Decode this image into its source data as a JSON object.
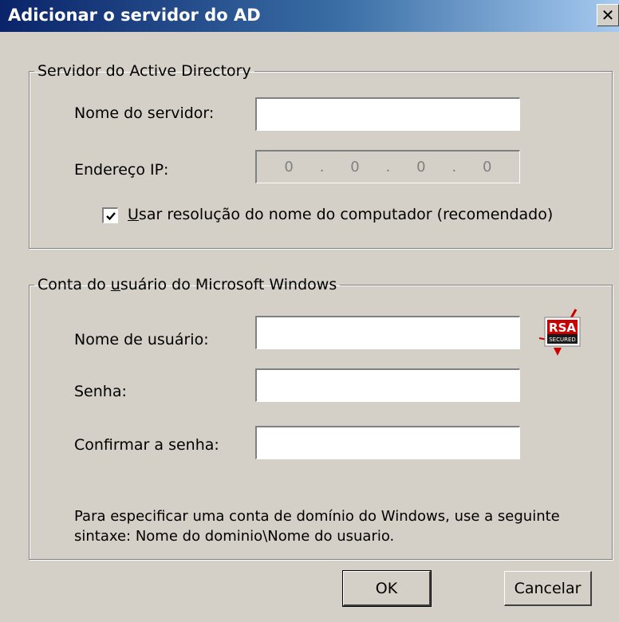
{
  "window": {
    "title": "Adicionar o servidor do AD",
    "close_label": "✕"
  },
  "ad_server_group": {
    "legend": "Servidor do Active Directory",
    "server_name_label": "Nome do servidor:",
    "server_name_value": "",
    "ip_label": "Endereço IP:",
    "ip_octets": [
      "0",
      "0",
      "0",
      "0"
    ],
    "ip_separator": ".",
    "use_name_resolution": {
      "checked": true,
      "label": "Usar resolução do nome do computador (recomendado)"
    }
  },
  "windows_account_group": {
    "legend": "Conta do usuário do Microsoft Windows",
    "username_label": "Nome de usuário:",
    "username_value": "",
    "password_label": "Senha:",
    "password_value": "",
    "confirm_label": "Confirmar a senha:",
    "confirm_value": "",
    "note_line1": "Para especificar uma conta de domínio do Windows, use a seguinte",
    "note_line2": "sintaxe: Nome  do  dominio\\Nome  do  usuario.",
    "logo": {
      "text": "RSA",
      "subtext": "SECURED",
      "icon": "rsa-secured-icon",
      "color": "#cc0000"
    }
  },
  "buttons": {
    "ok": "OK",
    "cancel": "Cancelar"
  }
}
